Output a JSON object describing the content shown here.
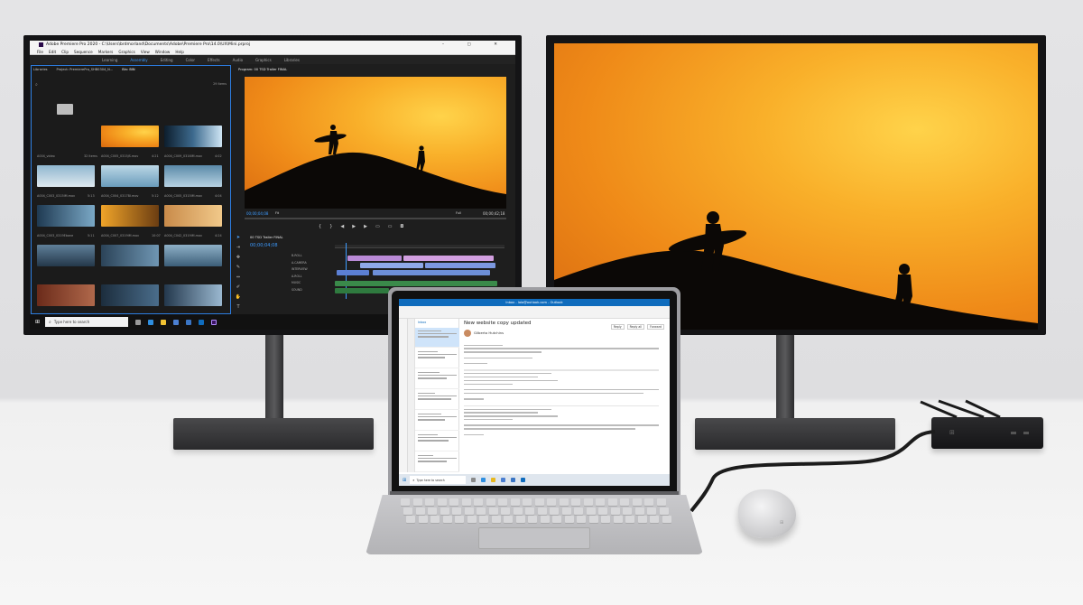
{
  "premiere": {
    "title": "Adobe Premiere Pro 2020 - C:\\Users\\brdmorland\\Documents\\Adobe\\Premiere Pro\\14.0\\UX\\Mini.prproj",
    "menu": [
      "File",
      "Edit",
      "Clip",
      "Sequence",
      "Markers",
      "Graphics",
      "View",
      "Window",
      "Help"
    ],
    "workspaces": [
      "Learning",
      "Assembly",
      "Editing",
      "Color",
      "Effects",
      "Audio",
      "Graphics",
      "Libraries"
    ],
    "active_workspace": "Assembly",
    "project_tabs": [
      "Libraries",
      "Project: PremierePro_SHB0304_N...",
      "Bin: BIN"
    ],
    "items_count": "29 Items",
    "clips": [
      {
        "name": "A004_video",
        "meta": "32 Items"
      },
      {
        "name": "A004_C005_0315JS.mov",
        "meta": "4:21"
      },
      {
        "name": "A004_C009_0316IM.mov",
        "meta": "4:02"
      },
      {
        "name": "A004_C003_0315IM.mov",
        "meta": "5:13"
      },
      {
        "name": "A004_C004_0317BI.mov",
        "meta": "5:12"
      },
      {
        "name": "A004_C005_0315IM.mov",
        "meta": "4:04"
      },
      {
        "name": "A004_C003_0319Ebane",
        "meta": "5:11"
      },
      {
        "name": "A004_C007_0319IM.mov",
        "meta": "10:07"
      },
      {
        "name": "A004_C042_0319IM.mov",
        "meta": "4:24"
      }
    ],
    "program_tab": "Program: 00 TSD Trailer FINAL",
    "program_timecode": "00;00;04;08",
    "fit_label": "Fit",
    "full_label": "Full",
    "duration": "00;00;42;18",
    "sequence_tab": "00 TSD Trailer FINAL",
    "sequence_timecode": "00;00;04;08",
    "track_labels": [
      "B-ROLL",
      "A-CAMERA",
      "INTERVIEW",
      "A-ROLL",
      "MUSIC",
      "SOUND"
    ],
    "search_placeholder": "Type here to search"
  },
  "outlook": {
    "window_title": "Inbox - lala@outlook.com - Outlook",
    "message_title": "New website copy updated",
    "sender": "Gilberto Hutchins",
    "folder": "Inbox",
    "actions": [
      "Reply",
      "Reply all",
      "Forward"
    ],
    "search_placeholder": "Type here to search"
  },
  "colors": {
    "accent_premiere": "#3d9bff",
    "accent_outlook": "#0f6cbd",
    "sunset": "#f3a322"
  }
}
